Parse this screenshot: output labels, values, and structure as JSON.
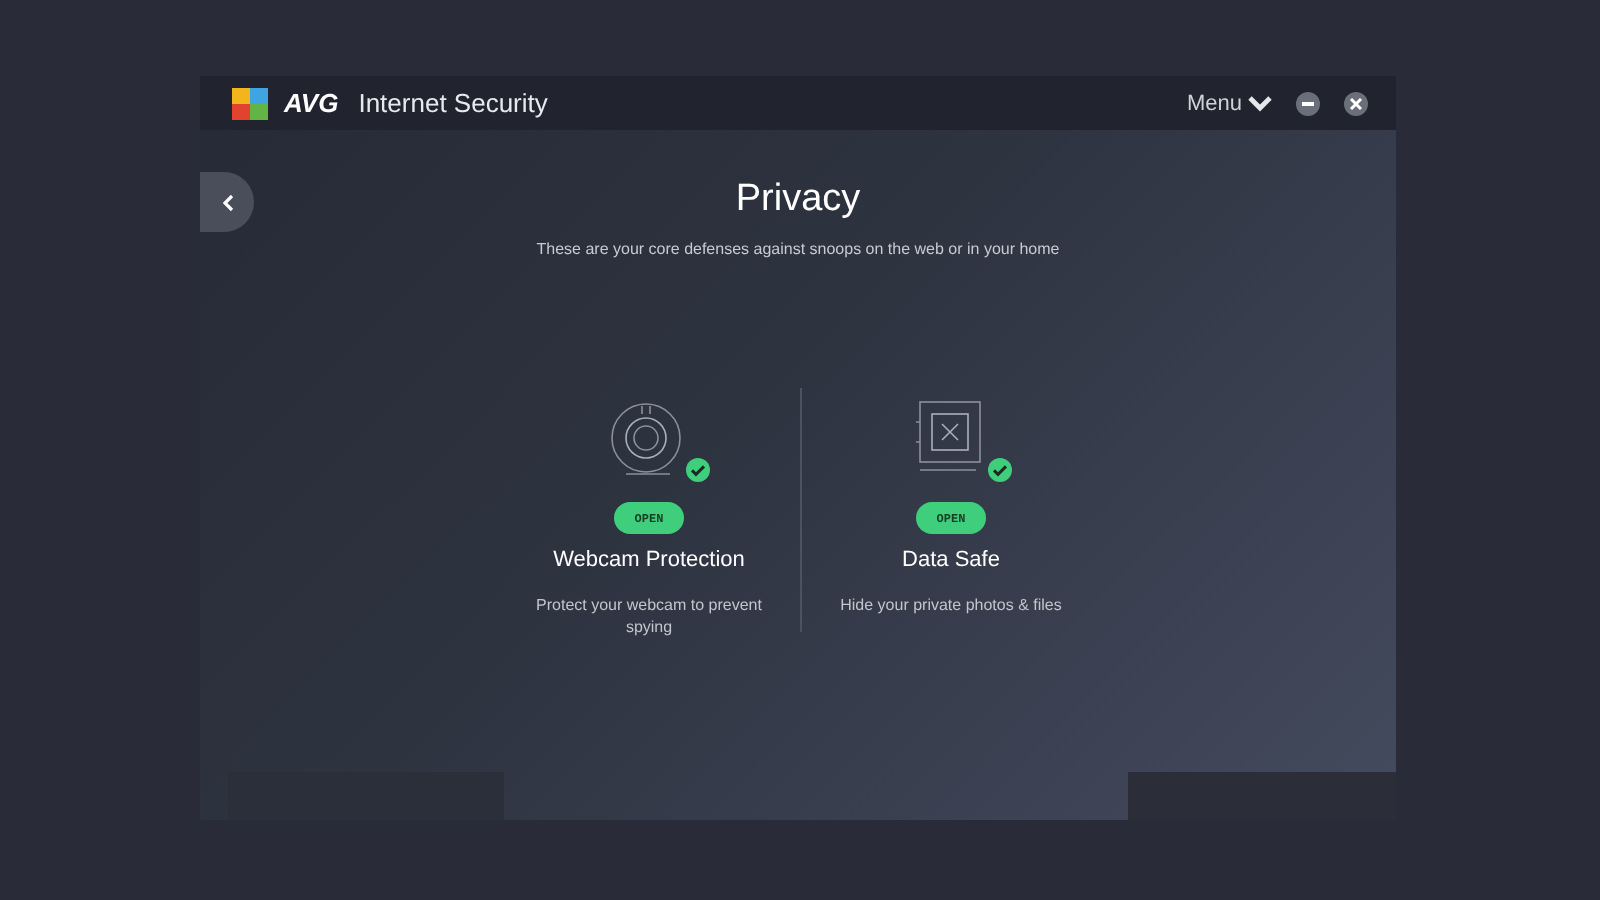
{
  "window": {
    "brand": "AVG",
    "title": "Internet Security",
    "menu": "Menu"
  },
  "page": {
    "title": "Privacy",
    "subtitle": "These are your core defenses against snoops on the web or in your home"
  },
  "features": [
    {
      "kind": "webcam",
      "protected": true,
      "button": "OPEN",
      "title": "Webcam Protection",
      "description": "Protect your webcam to prevent spying"
    },
    {
      "kind": "safe",
      "protected": true,
      "button": "OPEN",
      "title": "Data Safe",
      "description": "Hide your private photos & files"
    }
  ]
}
